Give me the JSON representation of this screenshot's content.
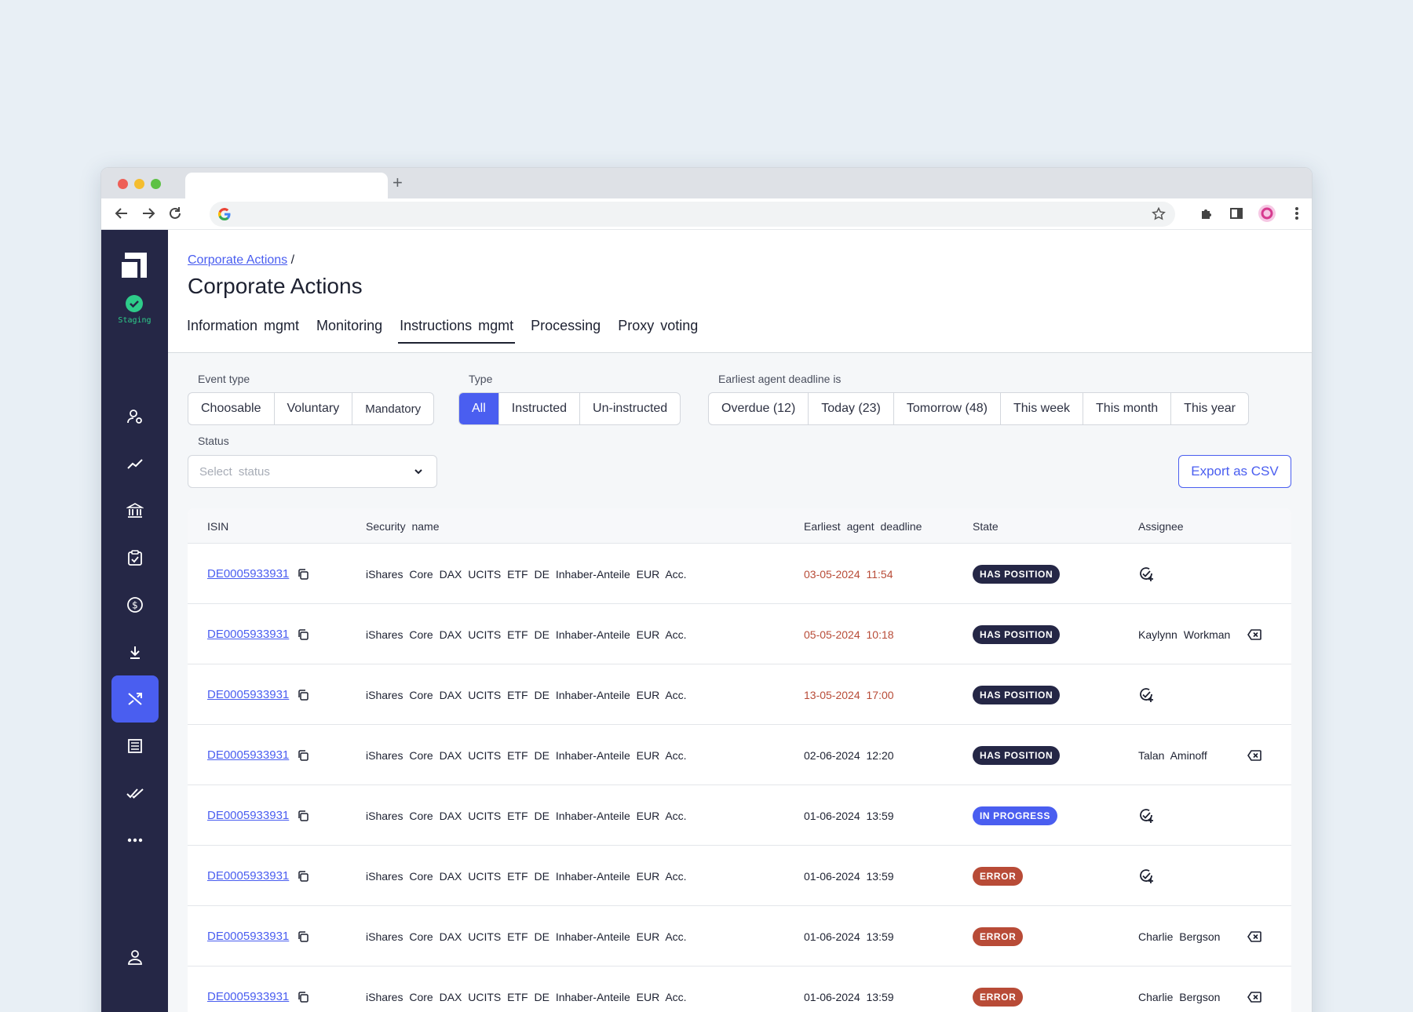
{
  "breadcrumb": {
    "link": "Corporate Actions",
    "sep": "/"
  },
  "page_title": "Corporate Actions",
  "env_label": "Staging",
  "tabs": [
    {
      "label": "Information mgmt"
    },
    {
      "label": "Monitoring"
    },
    {
      "label": "Instructions mgmt"
    },
    {
      "label": "Processing"
    },
    {
      "label": "Proxy voting"
    }
  ],
  "filters": {
    "event_type_label": "Event type",
    "event_type": [
      "Choosable",
      "Voluntary",
      "Mandatory"
    ],
    "type_label": "Type",
    "type": [
      "All",
      "Instructed",
      "Un-instructed"
    ],
    "deadline_label": "Earliest agent deadline is",
    "deadline": [
      "Overdue (12)",
      "Today (23)",
      "Tomorrow (48)",
      "This week",
      "This month",
      "This year"
    ],
    "status_label": "Status",
    "status_placeholder": "Select status",
    "export_label": "Export as CSV"
  },
  "table": {
    "headers": {
      "isin": "ISIN",
      "security": "Security name",
      "deadline": "Earliest agent deadline",
      "state": "State",
      "assignee": "Assignee"
    },
    "rows": [
      {
        "isin": "DE0005933931",
        "security": "iShares Core DAX UCITS ETF DE Inhaber-Anteile EUR Acc.",
        "deadline": "03-05-2024 11:54",
        "state": "HAS POSITION",
        "assignee": ""
      },
      {
        "isin": "DE0005933931",
        "security": "iShares Core DAX UCITS ETF DE Inhaber-Anteile EUR Acc.",
        "deadline": "05-05-2024 10:18",
        "state": "HAS POSITION",
        "assignee": "Kaylynn Workman"
      },
      {
        "isin": "DE0005933931",
        "security": "iShares Core DAX UCITS ETF DE Inhaber-Anteile EUR Acc.",
        "deadline": "13-05-2024 17:00",
        "state": "HAS POSITION",
        "assignee": ""
      },
      {
        "isin": "DE0005933931",
        "security": "iShares Core DAX UCITS ETF DE Inhaber-Anteile EUR Acc.",
        "deadline": "02-06-2024 12:20",
        "state": "HAS POSITION",
        "assignee": "Talan Aminoff"
      },
      {
        "isin": "DE0005933931",
        "security": "iShares Core DAX UCITS ETF DE Inhaber-Anteile EUR Acc.",
        "deadline": "01-06-2024 13:59",
        "state": "IN PROGRESS",
        "assignee": ""
      },
      {
        "isin": "DE0005933931",
        "security": "iShares Core DAX UCITS ETF DE Inhaber-Anteile EUR Acc.",
        "deadline": "01-06-2024 13:59",
        "state": "ERROR",
        "assignee": ""
      },
      {
        "isin": "DE0005933931",
        "security": "iShares Core DAX UCITS ETF DE Inhaber-Anteile EUR Acc.",
        "deadline": "01-06-2024 13:59",
        "state": "ERROR",
        "assignee": "Charlie Bergson"
      },
      {
        "isin": "DE0005933931",
        "security": "iShares Core DAX UCITS ETF DE Inhaber-Anteile EUR Acc.",
        "deadline": "01-06-2024 13:59",
        "state": "ERROR",
        "assignee": "Charlie Bergson"
      }
    ]
  },
  "colors": {
    "accent": "#4a5ef0",
    "sidebar": "#252746",
    "overdue": "#b84b37",
    "has_position": "#252746",
    "in_progress": "#4a5ef0",
    "error": "#b84b37",
    "staging": "#2ecc8a"
  }
}
